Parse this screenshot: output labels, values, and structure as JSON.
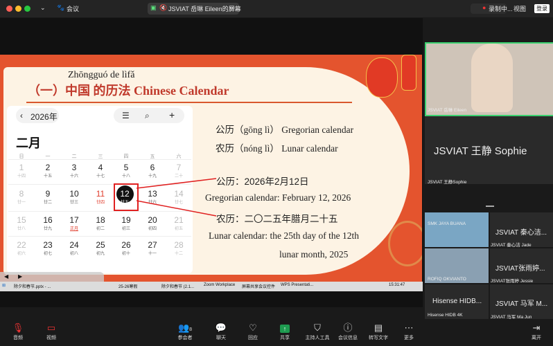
{
  "topbar": {
    "meeting_label": "会议",
    "share_title": "JSVIAT 岳琳 Eileen的屏幕",
    "recording": "录制中...",
    "view": "视图",
    "login": "登录"
  },
  "slide": {
    "pinyin": "Zhōngguó de lìfǎ",
    "title": "（一）中国   的历法 Chinese Calendar",
    "gongli_line": "公历（gōng lì）  Gregorian calendar",
    "nongli_line": "农历（nóng lì）  Lunar calendar",
    "gongli_date": "公历：2026年2月12日",
    "gregorian_date": "Gregorian calendar: February 12, 2026",
    "nongli_date": "农历：二〇二五年腊月二十五",
    "lunar_date_1": "Lunar calendar: the 25th day of the 12th",
    "lunar_date_2": "lunar month, 2025"
  },
  "calendar": {
    "year": "2026年",
    "month": "二月",
    "weekdays": [
      "日",
      "一",
      "二",
      "三",
      "四",
      "五",
      "六"
    ],
    "rows": [
      [
        [
          "1",
          "十四"
        ],
        [
          "2",
          "十五"
        ],
        [
          "3",
          "十六"
        ],
        [
          "4",
          "十七"
        ],
        [
          "5",
          "十八"
        ],
        [
          "6",
          "十九"
        ],
        [
          "7",
          "二十"
        ]
      ],
      [
        [
          "8",
          "廿一"
        ],
        [
          "9",
          "廿二"
        ],
        [
          "10",
          "廿三"
        ],
        [
          "11",
          "廿四"
        ],
        [
          "12",
          "廿五"
        ],
        [
          "13",
          "廿六"
        ],
        [
          "14",
          "廿七"
        ]
      ],
      [
        [
          "15",
          "廿八"
        ],
        [
          "16",
          "廿九"
        ],
        [
          "17",
          "正月"
        ],
        [
          "18",
          "初二"
        ],
        [
          "19",
          "初三"
        ],
        [
          "20",
          "初四"
        ],
        [
          "21",
          "初五"
        ]
      ],
      [
        [
          "22",
          "初六"
        ],
        [
          "23",
          "初七"
        ],
        [
          "24",
          "初八"
        ],
        [
          "25",
          "初九"
        ],
        [
          "26",
          "初十"
        ],
        [
          "27",
          "十一"
        ],
        [
          "28",
          "十二"
        ]
      ]
    ]
  },
  "taskbar": {
    "items": [
      "除夕和春节.pptx - ...",
      "25-26寒假",
      "除夕和春节 (2.1...",
      "Zoom Workplace",
      "屏幕共享会议控件",
      "WPS Presentati..."
    ],
    "time": "15:31:47"
  },
  "participants": {
    "presenter_tag": "JSVIAT 岳琳 Eileen",
    "sophie_big": "JSVIAT 王静 Sophie",
    "sophie_tag": "JSVIAT 王静Sophie",
    "t1_top": "SMK JAYA BUANA",
    "t1_big": "JSVIAT 秦心洁...",
    "t1_tag": "JSVIAT 秦心洁 Jade",
    "t2_top": "ROFIQ OKVIANTO",
    "t2_big": "JSVIAT张雨婷...",
    "t2_tag": "JSVIAT张雨婷 Jessie",
    "t3_big": "Hisense HIDB...",
    "t3_tag": "Hisense HIDB 4K",
    "t4_big": "JSVIAT 马军 M...",
    "t4_tag": "JSVIAT 马军 Ma Jun"
  },
  "toolbar": {
    "audio": "音频",
    "video": "视频",
    "participants": "参会者",
    "participant_count": "8",
    "chat": "聊天",
    "react": "回应",
    "share": "共享",
    "host_tools": "主持人工具",
    "meeting_info": "会议信息",
    "transcript": "转写文字",
    "more": "更多",
    "leave": "离开"
  },
  "colors": {
    "slide_red": "#e4542e",
    "title_red": "#c0392b",
    "share_green": "#1e9b50"
  }
}
